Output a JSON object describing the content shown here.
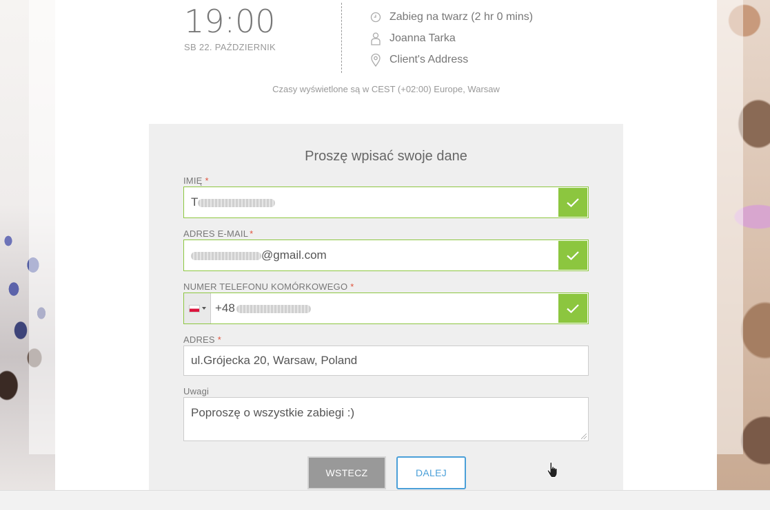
{
  "appointment": {
    "time": "19:00",
    "date": "SB 22. PAŹDZIERNIK",
    "service": "Zabieg na twarz (2 hr 0 mins)",
    "staff": "Joanna Tarka",
    "location": "Client's Address",
    "timezone_note": "Czasy wyświetlone są w CEST (+02:00) Europe, Warsaw"
  },
  "form": {
    "title": "Proszę wpisać swoje dane",
    "required_mark": "*",
    "name": {
      "label": "IMIĘ",
      "value_prefix": "T"
    },
    "email": {
      "label": "ADRES E-MAIL",
      "value_suffix": "@gmail.com"
    },
    "phone": {
      "label": "NUMER TELEFONU KOMÓRKOWEGO",
      "country": "PL",
      "value_prefix": "+48"
    },
    "address": {
      "label": "ADRES",
      "value": "ul.Grójecka 20, Warsaw, Poland"
    },
    "notes": {
      "label": "Uwagi",
      "value": "Poproszę o wszystkie zabiegi :)"
    },
    "back_label": "WSTECZ",
    "next_label": "DALEJ"
  },
  "colors": {
    "valid": "#8cc63f",
    "primary": "#4a9fd8",
    "required": "#e0533d"
  },
  "icons": {
    "service": "clock-icon",
    "staff": "person-icon",
    "location": "map-pin-icon",
    "valid": "checkmark-icon"
  }
}
